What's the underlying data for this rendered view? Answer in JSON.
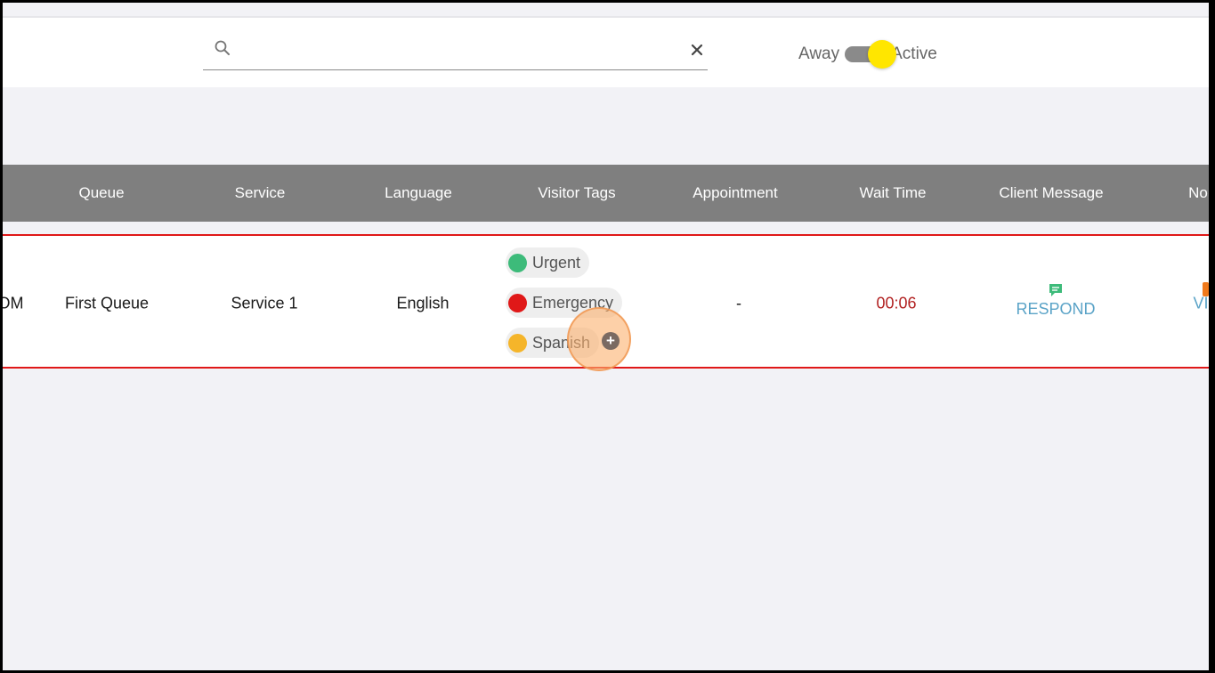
{
  "header": {
    "search": {
      "value": "",
      "placeholder": ""
    },
    "status": {
      "away_label": "Away",
      "active_label": "Active",
      "state": "Active"
    }
  },
  "table": {
    "columns": [
      "Queue",
      "Service",
      "Language",
      "Visitor Tags",
      "Appointment",
      "Wait Time",
      "Client Message",
      "No"
    ],
    "rows": [
      {
        "time_suffix": "OM",
        "queue": "First Queue",
        "service": "Service 1",
        "language": "English",
        "tags": [
          {
            "label": "Urgent",
            "color": "#3dbb7a"
          },
          {
            "label": "Emergency",
            "color": "#e01818"
          },
          {
            "label": "Spanish",
            "color": "#f5b52a"
          }
        ],
        "appointment": "-",
        "wait_time": "00:06",
        "client_message": "RESPOND",
        "notes_cut": "VI"
      }
    ]
  },
  "colors": {
    "header_bg": "#7f7f7f",
    "row_border": "#e01818",
    "wait_time": "#b22222",
    "link": "#5aa3c7",
    "toggle_knob": "#ffe600"
  }
}
